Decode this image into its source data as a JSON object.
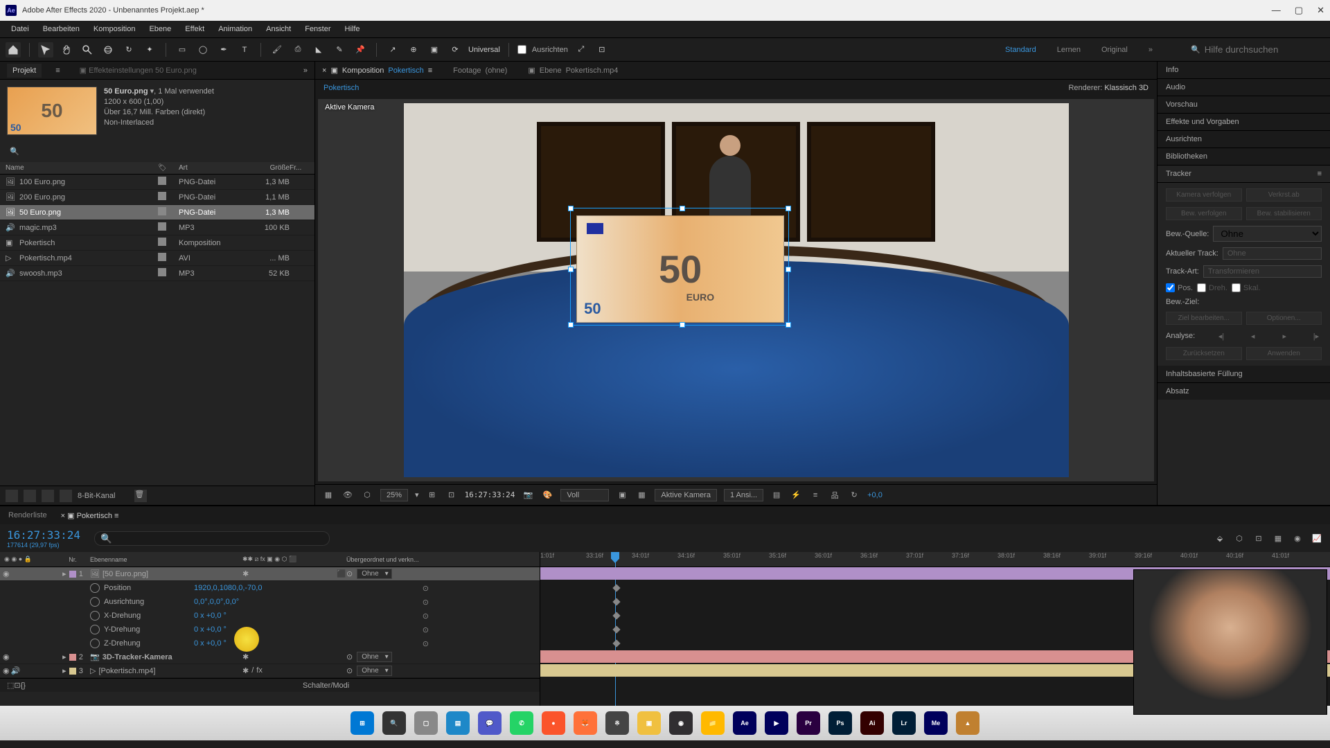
{
  "title": "Adobe After Effects 2020 - Unbenanntes Projekt.aep *",
  "menus": [
    "Datei",
    "Bearbeiten",
    "Komposition",
    "Ebene",
    "Effekt",
    "Animation",
    "Ansicht",
    "Fenster",
    "Hilfe"
  ],
  "toolbar": {
    "universal": "Universal",
    "ausrichten": "Ausrichten",
    "workspaces": {
      "standard": "Standard",
      "lernen": "Lernen",
      "original": "Original"
    },
    "help_placeholder": "Hilfe durchsuchen"
  },
  "project": {
    "tab_project": "Projekt",
    "tab_effect": "Effekteinstellungen 50 Euro.png",
    "asset_name": "50 Euro.png",
    "asset_used": ", 1 Mal verwendet",
    "asset_dims": "1200 x 600 (1,00)",
    "asset_colors": "Über 16,7 Mill. Farben (direkt)",
    "asset_interlace": "Non-Interlaced",
    "search_placeholder": "",
    "cols": {
      "name": "Name",
      "type": "Art",
      "size": "Größe",
      "fr": "Fr..."
    },
    "items": [
      {
        "name": "100 Euro.png",
        "type": "PNG-Datei",
        "size": "1,3 MB",
        "icon": "img"
      },
      {
        "name": "200 Euro.png",
        "type": "PNG-Datei",
        "size": "1,1 MB",
        "icon": "img"
      },
      {
        "name": "50 Euro.png",
        "type": "PNG-Datei",
        "size": "1,3 MB",
        "icon": "img",
        "selected": true
      },
      {
        "name": "magic.mp3",
        "type": "MP3",
        "size": "100 KB",
        "icon": "audio"
      },
      {
        "name": "Pokertisch",
        "type": "Komposition",
        "size": "",
        "icon": "comp"
      },
      {
        "name": "Pokertisch.mp4",
        "type": "AVI",
        "size": "... MB",
        "icon": "video"
      },
      {
        "name": "swoosh.mp3",
        "type": "MP3",
        "size": "52 KB",
        "icon": "audio"
      }
    ],
    "footer_bpc": "8-Bit-Kanal"
  },
  "viewer": {
    "tabs": {
      "comp_prefix": "Komposition",
      "comp_name": "Pokertisch",
      "footage_prefix": "Footage",
      "footage_name": "(ohne)",
      "layer_prefix": "Ebene",
      "layer_name": "Pokertisch.mp4"
    },
    "subtitle_name": "Pokertisch",
    "renderer_label": "Renderer:",
    "renderer_value": "Klassisch 3D",
    "camera_label": "Aktive Kamera",
    "footer": {
      "zoom": "25%",
      "timecode": "16:27:33:24",
      "res": "Voll",
      "view": "Aktive Kamera",
      "views": "1 Ansi...",
      "exposure": "+0,0"
    }
  },
  "right": {
    "panels": [
      "Info",
      "Audio",
      "Vorschau",
      "Effekte und Vorgaben",
      "Ausrichten",
      "Bibliotheken"
    ],
    "tracker": {
      "title": "Tracker",
      "btn_track": "Kamera verfolgen",
      "btn_stab": "Verkrst.ab",
      "btn_follow": "Bew. verfolgen",
      "btn_stab2": "Bew. stabilisieren",
      "source_label": "Bew.-Quelle:",
      "source_value": "Ohne",
      "curtrack_label": "Aktueller Track:",
      "curtrack_value": "Ohne",
      "tracktype_label": "Track-Art:",
      "tracktype_value": "Transformieren",
      "pos": "Pos.",
      "rot": "Dreh.",
      "scale": "Skal.",
      "target_label": "Bew.-Ziel:",
      "btn_edit": "Ziel bearbeiten...",
      "btn_opts": "Optionen...",
      "analyse": "Analyse:",
      "btn_reset": "Zurücksetzen",
      "btn_apply": "Anwenden"
    },
    "contentfill": "Inhaltsbasierte Füllung",
    "extra": "Absatz"
  },
  "timeline": {
    "tab_render": "Renderliste",
    "tab_comp": "Pokertisch",
    "timecode": "16:27:33:24",
    "subtime": "177614 (29,97 fps)",
    "cols": {
      "nr": "Nr.",
      "source": "Ebenenname",
      "parent": "Übergeordnet und verkn..."
    },
    "ruler": [
      "1:01f",
      "33:16f",
      "34:01f",
      "34:16f",
      "35:01f",
      "35:16f",
      "36:01f",
      "36:16f",
      "37:01f",
      "37:16f",
      "38:01f",
      "38:16f",
      "39:01f",
      "39:16f",
      "40:01f",
      "40:16f",
      "41:01f"
    ],
    "layers": [
      {
        "nr": "1",
        "name": "[50 Euro.png]",
        "parent": "Ohne",
        "selected": true,
        "color": "#b090c8"
      },
      {
        "nr": "2",
        "name": "3D-Tracker-Kamera",
        "parent": "Ohne",
        "color": "#d89090"
      },
      {
        "nr": "3",
        "name": "[Pokertisch.mp4]",
        "parent": "Ohne",
        "color": "#d8c890"
      }
    ],
    "props": [
      {
        "name": "Position",
        "value": "1920,0,1080,0,-70,0"
      },
      {
        "name": "Ausrichtung",
        "value": "0,0°,0,0°,0,0°"
      },
      {
        "name": "X-Drehung",
        "value": "0 x +0,0 °"
      },
      {
        "name": "Y-Drehung",
        "value": "0 x +0,0 °"
      },
      {
        "name": "Z-Drehung",
        "value": "0 x +0,0 °"
      }
    ],
    "footer_modi": "Schalter/Modi"
  },
  "taskbar": [
    {
      "name": "start",
      "bg": "#0078d4",
      "txt": "⊞"
    },
    {
      "name": "search",
      "bg": "#333",
      "txt": "🔍"
    },
    {
      "name": "taskview",
      "bg": "#888",
      "txt": "▢"
    },
    {
      "name": "explorer",
      "bg": "#1e88c8",
      "txt": "▤"
    },
    {
      "name": "teams",
      "bg": "#5059c9",
      "txt": "💬"
    },
    {
      "name": "whatsapp",
      "bg": "#25d366",
      "txt": "✆"
    },
    {
      "name": "brave",
      "bg": "#fb542b",
      "txt": "●"
    },
    {
      "name": "firefox",
      "bg": "#ff7139",
      "txt": "🦊"
    },
    {
      "name": "app1",
      "bg": "#444",
      "txt": "※"
    },
    {
      "name": "app2",
      "bg": "#f0c040",
      "txt": "▣"
    },
    {
      "name": "obs",
      "bg": "#302e31",
      "txt": "◉"
    },
    {
      "name": "files",
      "bg": "#ffb900",
      "txt": "📁"
    },
    {
      "name": "ae",
      "bg": "#00005b",
      "txt": "Ae"
    },
    {
      "name": "me",
      "bg": "#00005b",
      "txt": "▶"
    },
    {
      "name": "pr",
      "bg": "#2a0040",
      "txt": "Pr"
    },
    {
      "name": "ps",
      "bg": "#001e36",
      "txt": "Ps"
    },
    {
      "name": "ai",
      "bg": "#330000",
      "txt": "Ai"
    },
    {
      "name": "lr",
      "bg": "#001e36",
      "txt": "Lr"
    },
    {
      "name": "me2",
      "bg": "#00005b",
      "txt": "Me"
    },
    {
      "name": "app3",
      "bg": "#c08030",
      "txt": "▲"
    }
  ]
}
